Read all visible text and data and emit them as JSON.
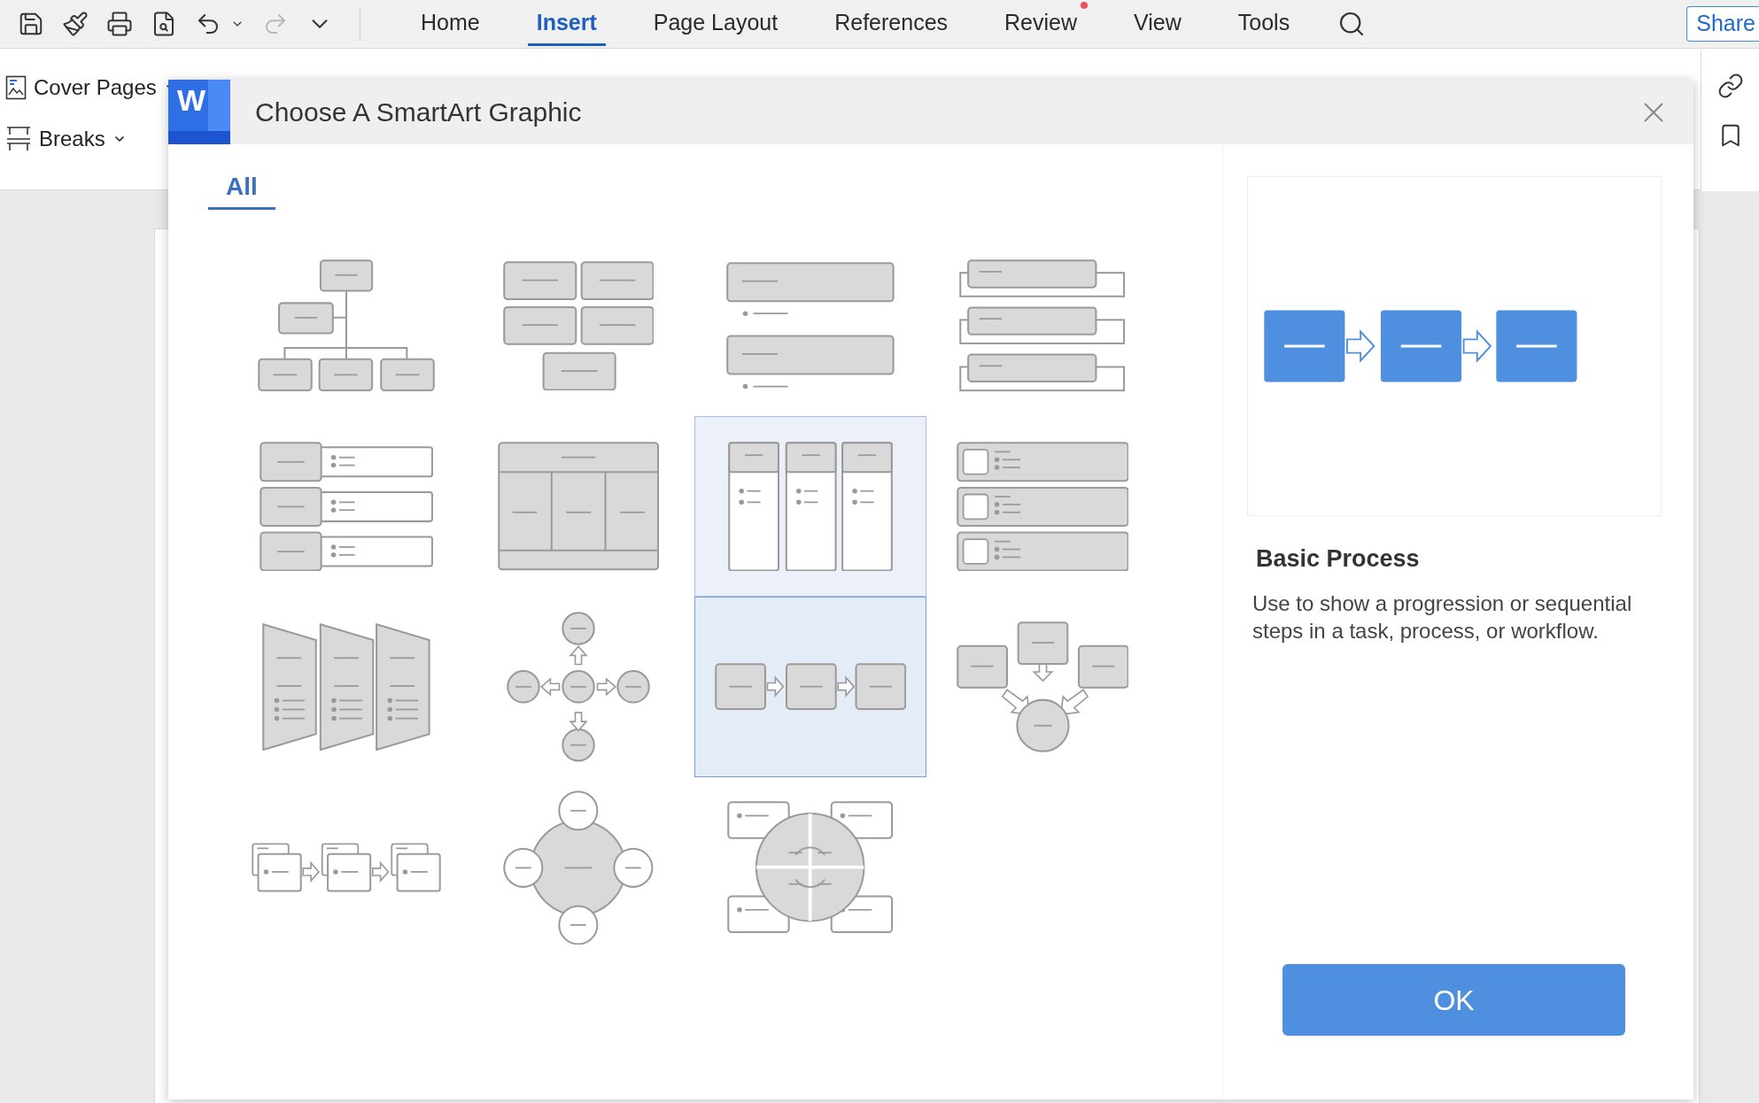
{
  "quick_access": [
    {
      "kind": "save"
    },
    {
      "kind": "format-painter"
    },
    {
      "kind": "print"
    },
    {
      "kind": "print-preview"
    },
    {
      "kind": "undo"
    },
    {
      "kind": "caret"
    },
    {
      "kind": "redo",
      "disabled": true
    },
    {
      "kind": "more"
    }
  ],
  "menu_tabs": [
    {
      "label": "Home",
      "selected": false,
      "notification": false
    },
    {
      "label": "Insert",
      "selected": true,
      "notification": false
    },
    {
      "label": "Page Layout",
      "selected": false,
      "notification": false
    },
    {
      "label": "References",
      "selected": false,
      "notification": false
    },
    {
      "label": "Review",
      "selected": false,
      "notification": true
    },
    {
      "label": "View",
      "selected": false,
      "notification": false
    },
    {
      "label": "Tools",
      "selected": false,
      "notification": false
    }
  ],
  "share_button": {
    "label": "Share"
  },
  "ribbon": {
    "items": [
      {
        "label": "Cover Pages",
        "kind": "cover"
      },
      {
        "label": "Breaks",
        "kind": "breaks"
      }
    ]
  },
  "dialog": {
    "logo_letter": "W",
    "title": "Choose A SmartArt Graphic",
    "tabs": [
      {
        "label": "All",
        "selected": true
      }
    ],
    "tiles": [
      {
        "kind": "hierarchy",
        "selected": false,
        "hovered": false
      },
      {
        "kind": "block-grid",
        "selected": false,
        "hovered": false
      },
      {
        "kind": "bar-list",
        "selected": false,
        "hovered": false
      },
      {
        "kind": "stacked-list",
        "selected": false,
        "hovered": false
      },
      {
        "kind": "label-list",
        "selected": false,
        "hovered": false
      },
      {
        "kind": "table",
        "selected": false,
        "hovered": false
      },
      {
        "kind": "columns",
        "selected": false,
        "hovered": true
      },
      {
        "kind": "checklist",
        "selected": false,
        "hovered": false
      },
      {
        "kind": "trapezoid",
        "selected": false,
        "hovered": false
      },
      {
        "kind": "radial-arrows",
        "selected": false,
        "hovered": false
      },
      {
        "kind": "process",
        "selected": true,
        "hovered": false
      },
      {
        "kind": "converge",
        "selected": false,
        "hovered": false
      },
      {
        "kind": "card-process",
        "selected": false,
        "hovered": false
      },
      {
        "kind": "hub",
        "selected": false,
        "hovered": false
      },
      {
        "kind": "quadrant",
        "selected": false,
        "hovered": false
      }
    ],
    "preview": {
      "title": "Basic Process",
      "description": "Use to show a progression or sequential steps in a task, process, or workflow."
    },
    "ok_button": {
      "label": "OK"
    }
  }
}
